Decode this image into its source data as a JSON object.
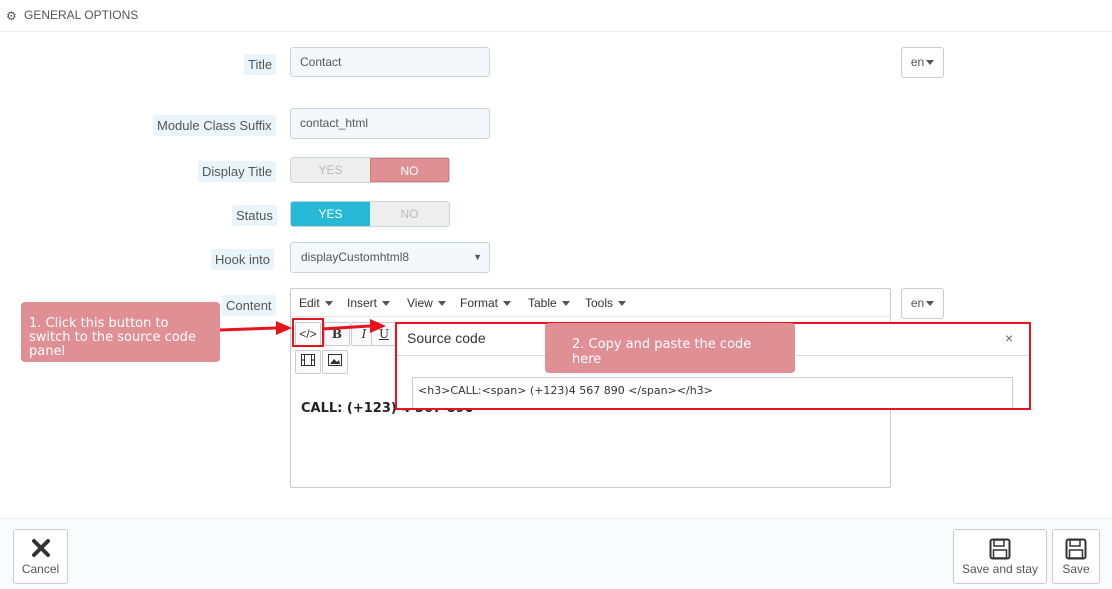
{
  "header": {
    "icon": "gears-icon",
    "title": "GENERAL OPTIONS"
  },
  "form": {
    "title": {
      "label": "Title",
      "value": "Contact",
      "lang": "en"
    },
    "suffix": {
      "label": "Module Class Suffix",
      "value": "contact_html"
    },
    "display_title": {
      "label": "Display Title",
      "yes": "YES",
      "no": "NO",
      "selected": "NO"
    },
    "status": {
      "label": "Status",
      "yes": "YES",
      "no": "NO",
      "selected": "YES"
    },
    "hook": {
      "label": "Hook into",
      "value": "displayCustomhtml8"
    },
    "content": {
      "label": "Content",
      "lang": "en"
    }
  },
  "editor": {
    "menus": [
      "Edit",
      "Insert",
      "View",
      "Format",
      "Table",
      "Tools"
    ],
    "tools": {
      "source": "</>",
      "bold": "B",
      "italic": "I",
      "underline": "U"
    },
    "content_text": "CALL: (+123) 4 567 890"
  },
  "dialog": {
    "title": "Source code",
    "close": "×",
    "code": "<h3>CALL:<span> (+123)4 567 890 </span></h3>"
  },
  "callouts": {
    "step1": "1. Click this button to switch to the source code panel",
    "step2": "2. Copy and paste the code here"
  },
  "footer": {
    "cancel": "Cancel",
    "save_and_stay": "Save and stay",
    "save": "Save"
  },
  "colors": {
    "accent": "#25b9d7",
    "no_active": "#e08f95",
    "callout": "#e08f95",
    "highlight": "#e8131d"
  }
}
